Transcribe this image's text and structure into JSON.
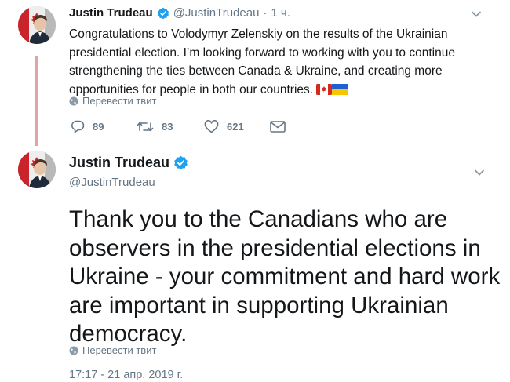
{
  "reply_tweet": {
    "author_name": "Justin Trudeau",
    "author_handle": "@JustinTrudeau",
    "time_sep": "·",
    "time_ago": "1 ч.",
    "text": "Congratulations to Volodymyr Zelenskiy on the results of the Ukrainian presidential election. I’m looking forward to working with you to continue strengthening the ties between Canada & Ukraine, and creating more opportunities for people in both our countries.",
    "emoji_flags": [
      "canada-flag",
      "ukraine-flag"
    ],
    "translate_label": "Перевести твит",
    "replies": "89",
    "retweets": "83",
    "likes": "621",
    "icons": {
      "reply": "reply-icon",
      "retweet": "retweet-icon",
      "like": "heart-icon",
      "dm": "envelope-icon",
      "menu": "chevron-down-icon"
    }
  },
  "main_tweet": {
    "author_name": "Justin Trudeau",
    "author_handle": "@JustinTrudeau",
    "text": "Thank you to the Canadians who are observers in the presidential elections in Ukraine - your commitment and hard work are important in supporting Ukrainian democracy.",
    "translate_label": "Перевести твит",
    "timestamp": "17:17 - 21 апр. 2019 г."
  },
  "colors": {
    "verified": "#1da1f2",
    "muted": "#657786",
    "thread_line": "#e0a3a6"
  }
}
